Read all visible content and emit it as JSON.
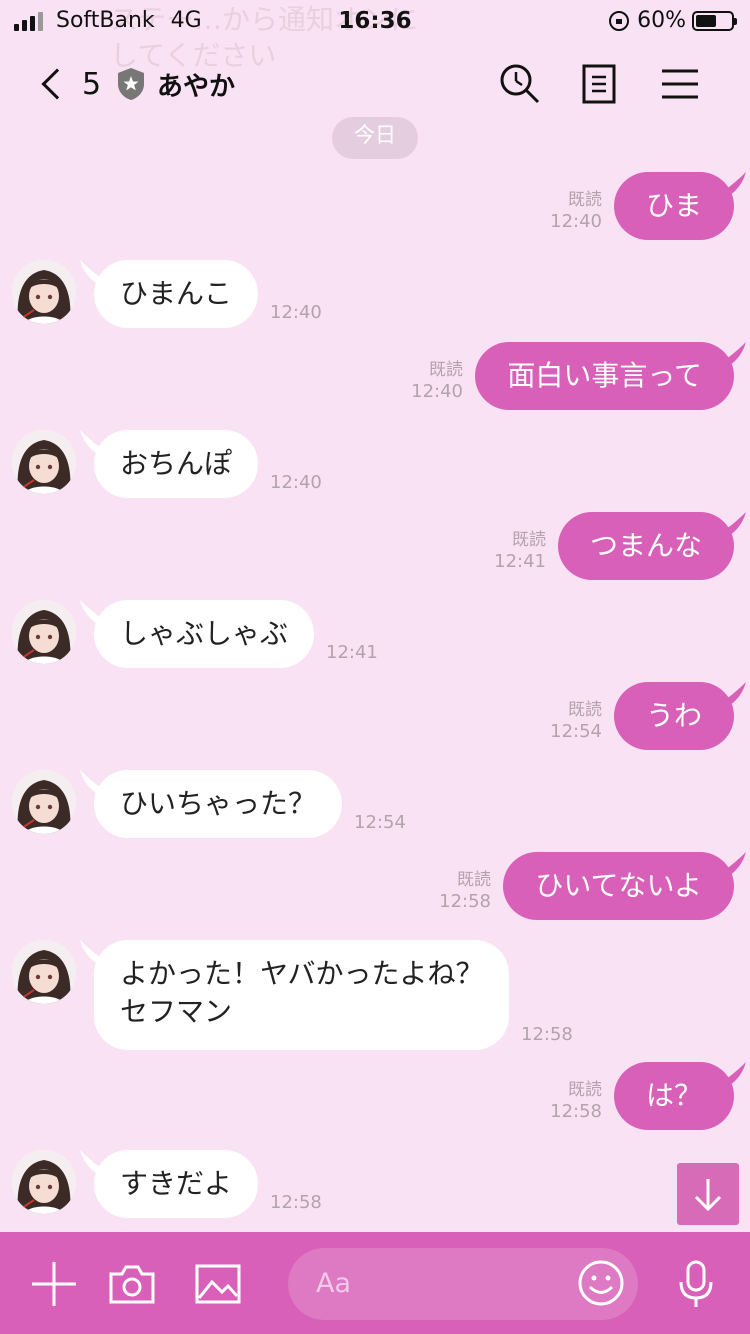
{
  "status_bar": {
    "carrier": "SoftBank",
    "network": "4G",
    "time": "16:36",
    "battery": "60%",
    "battery_level": 0.6
  },
  "background_notice": {
    "line1": "ステー…から通知オンに",
    "line2": "してください"
  },
  "header": {
    "back_count": "5",
    "title": "あやか"
  },
  "date_separator": "今日",
  "messages": [
    {
      "side": "sent",
      "text": "ひま",
      "read": "既読",
      "time": "12:40"
    },
    {
      "side": "received",
      "text": "ひまんこ",
      "time": "12:40"
    },
    {
      "side": "sent",
      "text": "面白い事言って",
      "read": "既読",
      "time": "12:40"
    },
    {
      "side": "received",
      "text": "おちんぽ",
      "time": "12:40"
    },
    {
      "side": "sent",
      "text": "つまんな",
      "read": "既読",
      "time": "12:41"
    },
    {
      "side": "received",
      "text": "しゃぶしゃぶ",
      "time": "12:41"
    },
    {
      "side": "sent",
      "text": "うわ",
      "read": "既読",
      "time": "12:54"
    },
    {
      "side": "received",
      "text": "ひいちゃった？",
      "time": "12:54"
    },
    {
      "side": "sent",
      "text": "ひいてないよ",
      "read": "既読",
      "time": "12:58"
    },
    {
      "side": "received",
      "text_line1": "よかった！ヤバかったよね？",
      "text_line2": "セフマン",
      "time": "12:58"
    },
    {
      "side": "sent",
      "text": "は？",
      "read": "既読",
      "time": "12:58"
    },
    {
      "side": "received",
      "text": "すきだよ",
      "time": "12:58"
    }
  ],
  "input": {
    "placeholder": "Aa"
  },
  "colors": {
    "background": "#f9e2f3",
    "accent": "#d860b8",
    "received_bubble": "#ffffff"
  }
}
